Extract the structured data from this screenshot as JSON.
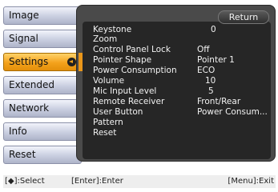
{
  "menu": {
    "tabs": [
      {
        "label": "Image"
      },
      {
        "label": "Signal"
      },
      {
        "label": "Settings"
      },
      {
        "label": "Extended"
      },
      {
        "label": "Network"
      },
      {
        "label": "Info"
      },
      {
        "label": "Reset"
      }
    ],
    "active_tab": "Settings"
  },
  "panel": {
    "return_label": "Return",
    "rows": [
      {
        "label": "Keystone",
        "value": "0"
      },
      {
        "label": "Zoom",
        "value": ""
      },
      {
        "label": "Control Panel Lock",
        "value": "Off"
      },
      {
        "label": "Pointer Shape",
        "value": "Pointer 1"
      },
      {
        "label": "Power Consumption",
        "value": "ECO"
      },
      {
        "label": "Volume",
        "value": "10"
      },
      {
        "label": "Mic Input Level",
        "value": "5"
      },
      {
        "label": "Remote Receiver",
        "value": "Front/Rear"
      },
      {
        "label": "User Button",
        "value": "Power Consum..."
      },
      {
        "label": "Pattern",
        "value": ""
      },
      {
        "label": "Reset",
        "value": ""
      }
    ]
  },
  "status_bar": {
    "select": "[◆]:Select",
    "enter": "[Enter]:Enter",
    "exit": "[Menu]:Exit"
  },
  "colors": {
    "active_tab": "#f4a21c",
    "panel_bg": "#262626",
    "panel_frame": "#4a4a4a"
  }
}
